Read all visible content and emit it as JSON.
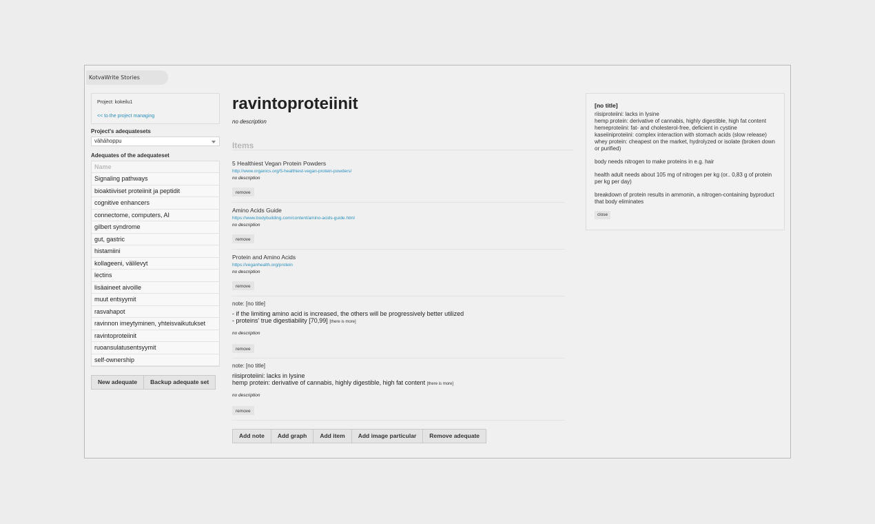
{
  "app": {
    "title": "KotvaWrite Stories"
  },
  "project": {
    "name": "Project: kokeilu1",
    "manage_link": "<< to the project managing"
  },
  "adequatesets": {
    "label": "Project's adequatesets",
    "selected": "vähähoppu"
  },
  "adequates": {
    "label": "Adequates of the adequateset",
    "header": "Name",
    "items": [
      "Signaling pathways",
      "bioaktiiviset proteiinit ja peptidit",
      "cognitive enhancers",
      "connectome, computers, AI",
      "gilbert syndrome",
      "gut, gastric",
      "histamiini",
      "kollageeni, välilevyt",
      "lectins",
      "lisäaineet aivoille",
      "muut entsyymit",
      "rasvahapot",
      "ravinnon imeytyminen, yhteisvaikutukset",
      "ravintoproteiinit",
      "ruoansulatusentsyymit",
      "self-ownership"
    ],
    "buttons": {
      "new": "New adequate",
      "backup": "Backup adequate set"
    }
  },
  "main": {
    "title": "ravintoproteiinit",
    "description": "no description",
    "items_heading": "Items",
    "items": [
      {
        "title": "5 Healthiest Vegan Protein Powders",
        "link": "http://www.organics.org/5-healthiest-vegan-protein-powders/",
        "description": "no description",
        "remove": "remove"
      },
      {
        "title": "Amino Acids Guide",
        "link": "https://www.bodybuilding.com/content/amino-acids-guide.html",
        "description": "no description",
        "remove": "remove"
      },
      {
        "title": "Protein and Amino Acids",
        "link": "https://veganhealth.org/protein",
        "description": "no description",
        "remove": "remove"
      }
    ],
    "notes": [
      {
        "title": "note: [no title]",
        "line1": "- if the limiting amino acid is increased, the others will be progressively better utilized",
        "line2": "- proteins' true digestiability [70,99]",
        "more": "[there is more]",
        "description": "no description",
        "remove": "remove"
      },
      {
        "title": "note: [no title]",
        "line1": "riisiproteiini: lacks in lysine",
        "line2": "hemp protein: derivative of cannabis, highly digestible, high fat content",
        "more": "[there is more]",
        "description": "no description",
        "remove": "remove"
      }
    ],
    "actions": {
      "add_note": "Add note",
      "add_graph": "Add graph",
      "add_item": "Add item",
      "add_image": "Add image particular",
      "remove_adequate": "Remove adequate"
    }
  },
  "note_panel": {
    "title": "[no title]",
    "lines": [
      "riisiproteiini: lacks in lysine",
      "hemp protein: derivative of cannabis, highly digestible, high fat content",
      "hemeproteiini: fat- and cholesterol-free, deficient in cystine",
      "kaseiiniproteiini: complex interaction with stomach acids (slow release)",
      "whey protein: cheapest on the market, hydrolyzed or isolate (broken down or purified)"
    ],
    "para2": "body needs nitrogen to make proteins in e.g. hair",
    "para3": "health adult needs about 105 mg of nitrogen per kg (or.. 0,83 g of protein per kg per day)",
    "para4": "breakdown of protein results in ammonin, a nitrogen-containing byproduct that body eliminates",
    "close": "close"
  }
}
